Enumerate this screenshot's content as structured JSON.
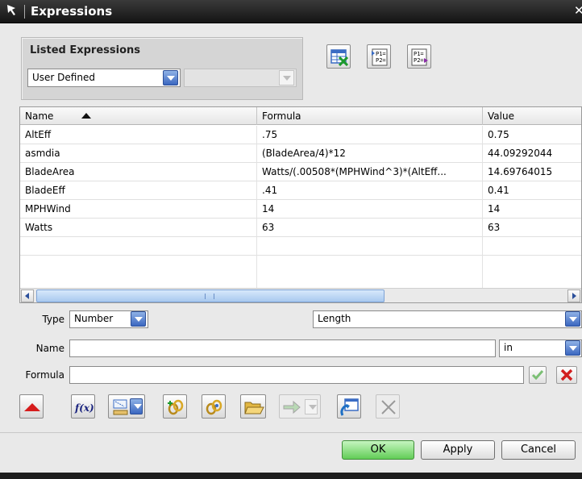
{
  "window": {
    "title": "Expressions",
    "close_glyph": "✕"
  },
  "listed": {
    "group_label": "Listed Expressions",
    "filter_value": "User Defined",
    "secondary_value": ""
  },
  "toolbar_top": {
    "icons": [
      "export-to-spreadsheet-icon",
      "list-expressions-icon",
      "list-references-icon"
    ],
    "p1": "P1=",
    "p2": "P2="
  },
  "table": {
    "columns": [
      "Name",
      "Formula",
      "Value"
    ],
    "sort_column": "Name",
    "rows": [
      {
        "name": "AltEff",
        "formula": ".75",
        "value": "0.75"
      },
      {
        "name": "asmdia",
        "formula": "(BladeArea/4)*12",
        "value": "44.09292044"
      },
      {
        "name": "BladeArea",
        "formula": "Watts/(.00508*(MPHWind^3)*(AltEff...",
        "value": "14.69764015"
      },
      {
        "name": "BladeEff",
        "formula": ".41",
        "value": "0.41"
      },
      {
        "name": "MPHWind",
        "formula": "14",
        "value": "14"
      },
      {
        "name": "Watts",
        "formula": "63",
        "value": "63"
      }
    ],
    "scroll_grip": "|||"
  },
  "form": {
    "type_label": "Type",
    "type_value": "Number",
    "dimension_value": "Length",
    "name_label": "Name",
    "name_value": "",
    "unit_value": "in",
    "formula_label": "Formula",
    "formula_value": ""
  },
  "toolbar_bottom": {
    "icons": [
      "collapse-up-icon",
      "function-icon",
      "measure-icon",
      "link-icon",
      "interpart-icon",
      "open-folder-icon",
      "apply-arrow-icon",
      "create-expression-icon",
      "delete-icon"
    ],
    "fx_text": "f(x)"
  },
  "buttons": {
    "ok": "OK",
    "apply": "Apply",
    "cancel": "Cancel"
  },
  "colors": {
    "accent": "#3b67c0",
    "ok_green": "#62cd57",
    "title_bg": "#1e1e1e"
  }
}
